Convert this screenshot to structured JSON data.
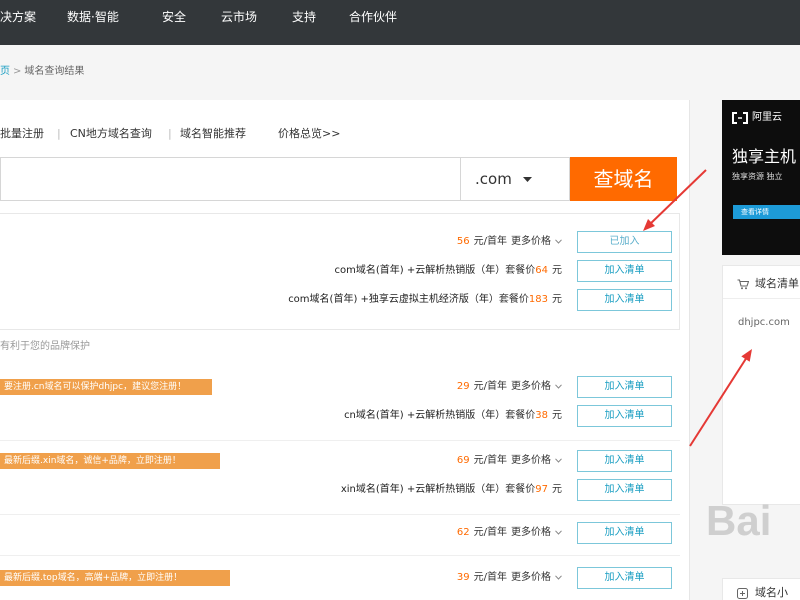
{
  "nav": {
    "items": [
      "决方案",
      "数据·智能",
      "安全",
      "云市场",
      "支持",
      "合作伙伴"
    ]
  },
  "breadcrumb": {
    "home": "页",
    "separator": ">",
    "current": "域名查询结果"
  },
  "tools": {
    "links": [
      "批量注册",
      "CN地方域名查询",
      "域名智能推荐",
      "价格总览>>"
    ],
    "separator": "|"
  },
  "search": {
    "suffix": ".com",
    "button": "查域名"
  },
  "primary": {
    "price": "56",
    "unit": "元/首年",
    "more": "更多价格",
    "button": "已加入",
    "packages": [
      {
        "name": "com域名(首年) +云解析热销版（年）",
        "label": "套餐价",
        "price": "64",
        "unit": "元",
        "button": "加入清单"
      },
      {
        "name": "com域名(首年) +独享云虚拟主机经济版（年）",
        "label": "套餐价",
        "price": "183",
        "unit": "元",
        "button": "加入清单"
      }
    ]
  },
  "brand_tip": "有利于您的品牌保护",
  "suggestions": [
    {
      "tag": "要注册.cn域名可以保护dhjpc，建议您注册！",
      "price": "29",
      "unit": "元/首年",
      "more": "更多价格",
      "button": "加入清单",
      "package": {
        "name": "cn域名(首年) +云解析热销版（年）",
        "label": "套餐价",
        "price": "38",
        "unit": "元",
        "button": "加入清单"
      }
    },
    {
      "tag": "最新后缀.xin域名，诚信+品牌，立即注册！",
      "price": "69",
      "unit": "元/首年",
      "more": "更多价格",
      "button": "加入清单",
      "package": {
        "name": "xin域名(首年) +云解析热销版（年）",
        "label": "套餐价",
        "price": "97",
        "unit": "元",
        "button": "加入清单"
      }
    },
    {
      "price": "62",
      "unit": "元/首年",
      "more": "更多价格",
      "button": "加入清单"
    },
    {
      "tag": "最新后缀.top域名，高端+品牌，立即注册！",
      "price": "39",
      "unit": "元/首年",
      "more": "更多价格",
      "button": "加入清单"
    }
  ],
  "ad": {
    "logo": "阿里云",
    "headline": "独享主机",
    "subline": "独享资源 独立",
    "cta": "查看详情"
  },
  "cart": {
    "title": "域名清单",
    "items": [
      "dhjpc.com"
    ]
  },
  "helper": {
    "title": "域名小"
  },
  "watermark": "Bai",
  "icons": {
    "logo": "aliyun-logo-icon",
    "cart": "cart-icon",
    "more": "chevron-down-icon",
    "suffix": "caret-down-icon",
    "helper": "domain-helper-icon"
  },
  "colors": {
    "nav_bg": "#33373a",
    "accent": "#ff6a00",
    "link": "#1a9ec2",
    "tag_bg": "#f0a04b",
    "ad_cta": "#1d9bd8",
    "annotation": "#e53935"
  }
}
